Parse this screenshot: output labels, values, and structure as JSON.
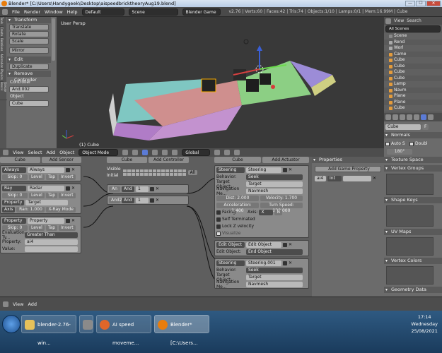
{
  "window": {
    "title": "Blender* [C:\\Users\\Handygeek\\Desktop\\aispeedbricktheoryAug19.blend]",
    "min": "—",
    "max": "☐",
    "close": "✕"
  },
  "infobar": {
    "menus": [
      "File",
      "Render",
      "Window",
      "Help"
    ],
    "layout": "Default",
    "scene": "Scene",
    "engine": "Blender Game",
    "stats": "v2.76 | Verts:60 | Faces:42 | Tris:74 | Objects:1/10 | Lamps:0/1 | Mem:16.99M | Cube"
  },
  "toolshelf": {
    "tabs": [
      "Tools",
      "Create",
      "Relations",
      "Animation",
      "Physics",
      "Grease Pencil"
    ],
    "transform_header": "Transform",
    "transform_buttons": [
      "Translate",
      "Rotate",
      "Scale"
    ],
    "mirror": "Mirror",
    "edit_header": "Edit",
    "edit_button": "Duplicate",
    "remove_controller": "Remove Controller",
    "controller_label": "Controller",
    "controller_value": "And.002",
    "object_label": "Object",
    "object_value": "Cube"
  },
  "viewport": {
    "label": "User Persp",
    "object_label": "(1) Cube",
    "header_items": [
      "View",
      "Select",
      "Add",
      "Object"
    ],
    "mode": "Object Mode",
    "orientation": "Global"
  },
  "logic": {
    "sensors_col": "Cube",
    "add_sensor": "Add Sensor",
    "controllers_col": "Cube",
    "add_controller": "Add Controller",
    "actuators_col": "Cube",
    "add_actuator": "Add Actuator",
    "visible": "Visible",
    "initial": "Initial",
    "all": "All",
    "sensors": [
      {
        "type": "Always",
        "name": "Always",
        "skip": "Skip:",
        "skip_val": "0",
        "level": "Level",
        "tap": "Tap",
        "invert": "Invert"
      },
      {
        "type": "Ray",
        "name": "Radar",
        "skip": "Skip:",
        "skip_val": "0",
        "level": "Level",
        "tap": "Tap",
        "invert": "Invert",
        "property": "Property",
        "target": "Target",
        "axis": "Axis",
        "ran": "Ran:",
        "ran_val": "1.000",
        "xray": "X-Ray Mode"
      },
      {
        "type": "Property",
        "name": "Property",
        "skip": "Skip:",
        "skip_val": "0",
        "level": "Level",
        "tap": "Tap",
        "invert": "Invert",
        "eval_label": "Evaluation Ty...",
        "eval": "Greater Than",
        "prop_label": "Property:",
        "prop_val": "ai4",
        "value_label": "Value:"
      }
    ],
    "controllers": [
      {
        "name": "An",
        "type": "And",
        "num": "1"
      },
      {
        "name": "And2",
        "type": "And",
        "num": "1"
      }
    ],
    "actuators": [
      {
        "type": "Steering",
        "name": "Steering",
        "behavior_label": "Behavior:",
        "behavior": "Seek",
        "target_label": "Target Object:",
        "target": "Target",
        "nav_label": "Navigation Me...",
        "nav": "Navmesh",
        "dist": "Dist:",
        "dist_val": "2.000",
        "velocity": "Velocity:",
        "velocity_val": "1.700",
        "accel": "Acceleration:",
        "accel_val": "1.400",
        "turn": "Turn Speed:",
        "turn_val": "120.000",
        "facing": "Facing",
        "axis": "Axis:",
        "axis_val": "X",
        "normal": "N",
        "self_term": "Self Terminated",
        "lock_z": "Lock Z velocity",
        "visualize": "Visualize"
      },
      {
        "type": "Edit Object",
        "name": "Edit Object",
        "edit_label": "Edit Object:",
        "edit_val": "End Object"
      },
      {
        "type": "Steering",
        "name": "Steering.001",
        "behavior_label": "Behavior:",
        "behavior": "Seek",
        "target_label": "Target Object:",
        "target": "Target",
        "nav_label": "Navigation Me...",
        "nav": "Navmesh"
      }
    ]
  },
  "gameprops": {
    "header": "Properties",
    "add": "Add Game Property",
    "prop_name": "ai4",
    "prop_type": "Int"
  },
  "outliner": {
    "view": "View",
    "search": "Search",
    "all": "All Scenes",
    "items": [
      "Scene",
      "Rend",
      "Worl",
      "Came",
      "Cube",
      "Cube",
      "Cube",
      "Cube",
      "Lamp",
      "Navm",
      "Plane",
      "Plane",
      "Cube"
    ]
  },
  "props": {
    "object": "Cube",
    "f_btn": "F",
    "sections": [
      "Normals",
      "Texture Space",
      "Vertex Groups",
      "Shape Keys",
      "UV Maps",
      "Vertex Colors",
      "Geometry Data"
    ],
    "auto_smooth": "Auto S",
    "double": "Doubl",
    "angle": "180°"
  },
  "bottombar": {
    "items": [
      "View",
      "Add"
    ]
  },
  "taskbar": {
    "tasks": [
      "blender-2.76-win...",
      "AI speed moveme...",
      "Blender* [C:\\Users..."
    ],
    "time": "17:14",
    "day": "Wednesday",
    "date": "25/08/2021"
  }
}
